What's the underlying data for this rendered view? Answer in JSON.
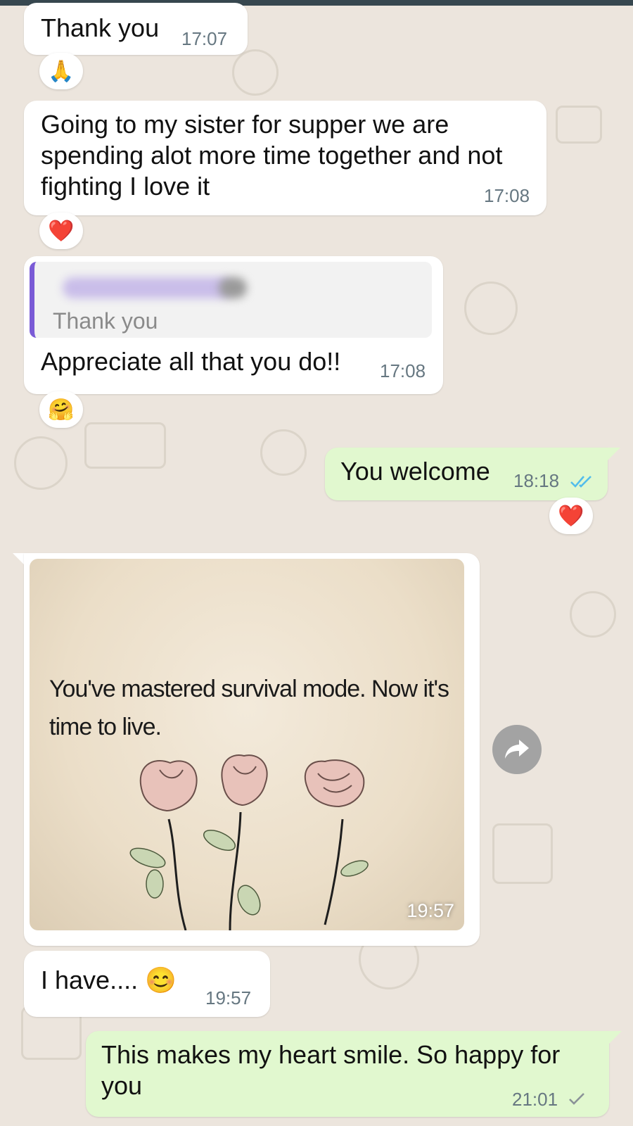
{
  "messages": [
    {
      "text": "Thank you",
      "time": "17:07",
      "reaction": "🙏"
    },
    {
      "text": "Going to my sister for supper we are spending alot more time together and not fighting I love it",
      "time": "17:08",
      "reaction": "❤️"
    },
    {
      "quoted": "Thank you",
      "text": "Appreciate all that you do!!",
      "time": "17:08",
      "reaction": "🤗"
    },
    {
      "text": "You welcome",
      "time": "18:18",
      "reaction": "❤️"
    },
    {
      "image_text": "You've mastered survival mode. Now it's time to live.",
      "time": "19:57"
    },
    {
      "text": "I have.... 😊",
      "time": "19:57"
    },
    {
      "text": "This makes my heart smile. So happy for you",
      "time": "21:01"
    }
  ],
  "icons": {
    "forward": "forward-arrow-icon",
    "read": "double-check-icon",
    "sent": "single-check-icon"
  },
  "colors": {
    "background": "#ece5dd",
    "incoming": "#ffffff",
    "outgoing": "#e1f8cf",
    "read_check": "#53bdeb",
    "quote_bar": "#7a5bd6"
  }
}
